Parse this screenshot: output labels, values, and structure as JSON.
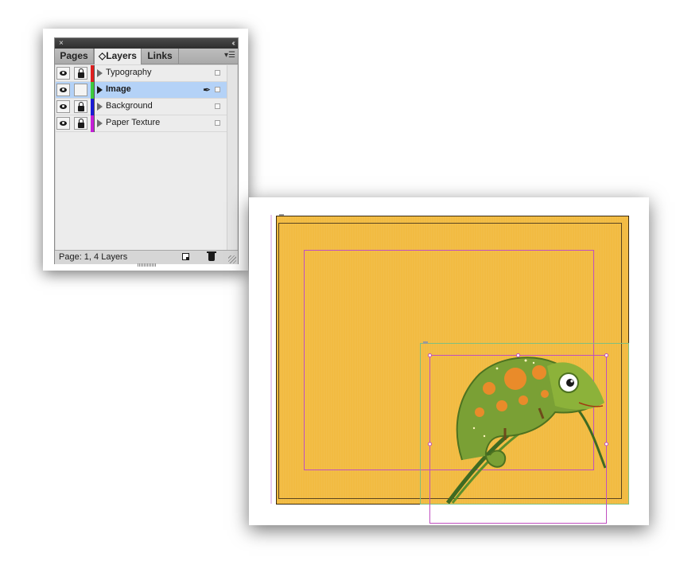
{
  "panel": {
    "close_glyph": "×",
    "collapse_glyph": "‹‹",
    "tabs": [
      {
        "label": "Pages",
        "active": false
      },
      {
        "label": "◇Layers",
        "active": true
      },
      {
        "label": "Links",
        "active": false
      }
    ],
    "menu_glyph": "▾☰",
    "layers": [
      {
        "name": "Typography",
        "color": "#e01e1e",
        "visible": true,
        "locked": true,
        "selected": false
      },
      {
        "name": "Image",
        "color": "#3ccc3c",
        "visible": true,
        "locked": false,
        "selected": true
      },
      {
        "name": "Background",
        "color": "#1a1ad6",
        "visible": true,
        "locked": true,
        "selected": false
      },
      {
        "name": "Paper Texture",
        "color": "#c51ed8",
        "visible": true,
        "locked": true,
        "selected": false
      }
    ],
    "pen_glyph": "✒",
    "status": "Page: 1, 4 Layers"
  },
  "colors": {
    "page_fill": "#f2bb42",
    "selection_blue": "#b4d2f7",
    "frame_magenta": "#c04fc0"
  }
}
